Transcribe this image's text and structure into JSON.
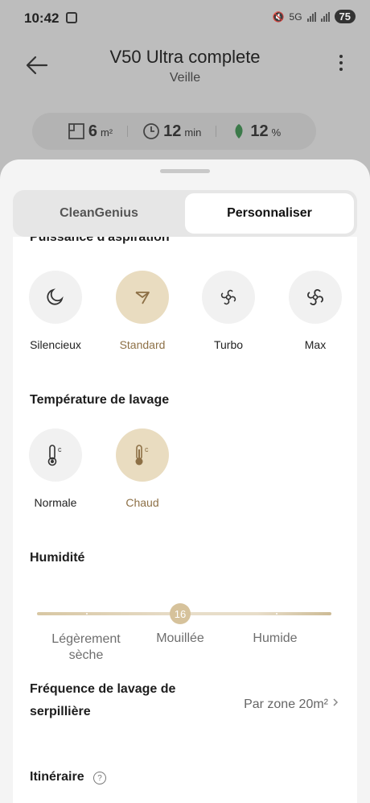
{
  "status": {
    "time": "10:42",
    "network": "5G",
    "battery": "75"
  },
  "header": {
    "title": "V50 Ultra complete",
    "subtitle": "Veille"
  },
  "stats": [
    {
      "value": "6",
      "unit": "m²",
      "icon": "area-icon"
    },
    {
      "value": "12",
      "unit": "min",
      "icon": "clock-icon"
    },
    {
      "value": "12",
      "unit": "%",
      "icon": "battery-leaf-icon"
    }
  ],
  "tabs": {
    "cleangenius": "CleanGenius",
    "customize": "Personnaliser",
    "active": "Personnaliser"
  },
  "suction": {
    "title": "Puissance d'aspiration",
    "options": [
      "Silencieux",
      "Standard",
      "Turbo",
      "Max"
    ],
    "selected": "Standard"
  },
  "temperature": {
    "title": "Température de lavage",
    "options": [
      "Normale",
      "Chaud"
    ],
    "selected": "Chaud"
  },
  "humidity": {
    "title": "Humidité",
    "value": "16",
    "labels": [
      "Légèrement sèche",
      "Mouillée",
      "Humide"
    ]
  },
  "mop_frequency": {
    "label": "Fréquence de lavage de serpillière",
    "value": "Par zone 20m²"
  },
  "route": {
    "label": "Itinéraire",
    "help": "?"
  },
  "colors": {
    "accent": "#8d7046",
    "selected_bg": "#e9dcc0"
  }
}
